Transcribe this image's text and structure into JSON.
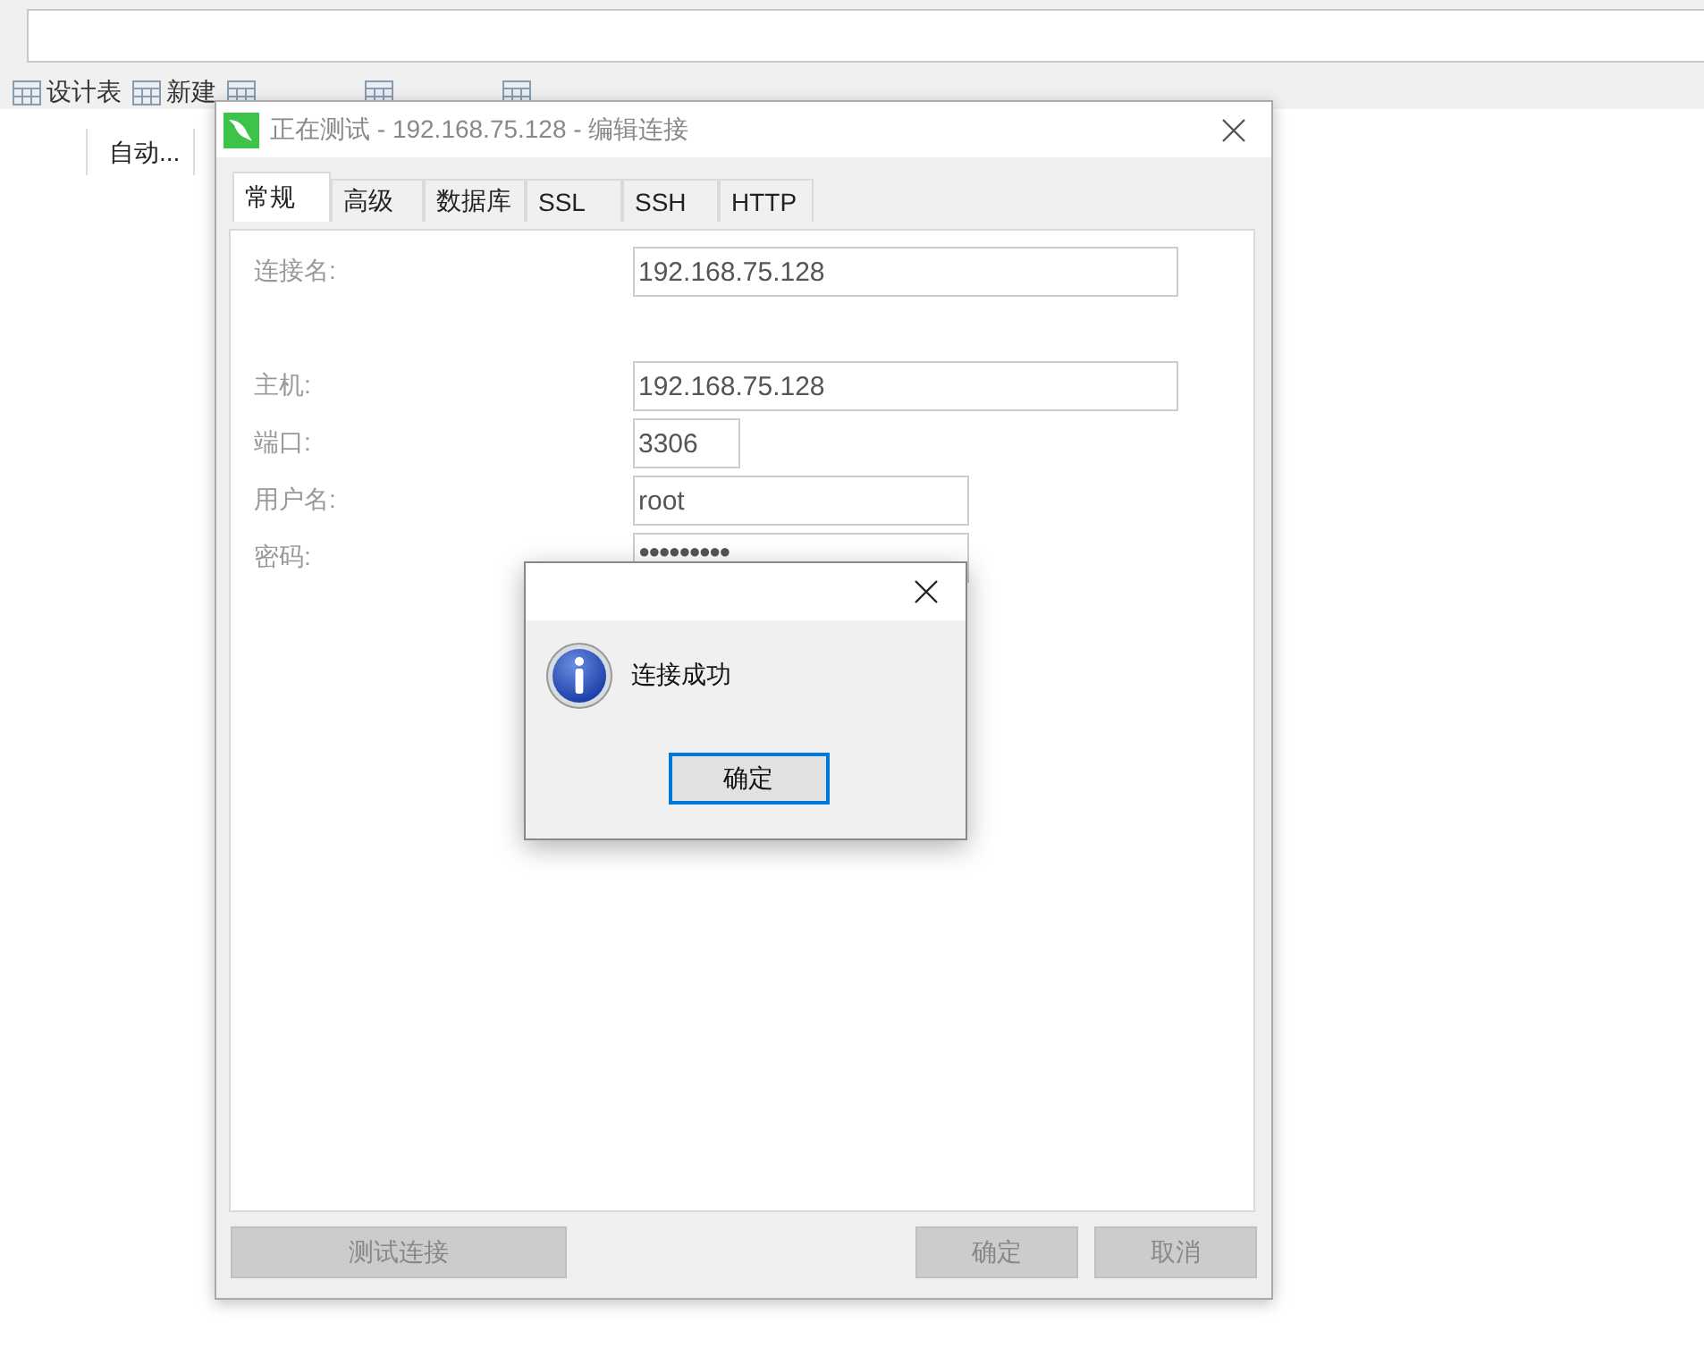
{
  "toolbar_labels": [
    "设计表",
    "新建"
  ],
  "columns": [
    "自动..."
  ],
  "dialog": {
    "title": "正在测试 - 192.168.75.128 - 编辑连接",
    "tabs": [
      {
        "label": "常规",
        "selected": true
      },
      {
        "label": "高级",
        "selected": false
      },
      {
        "label": "数据库",
        "selected": false
      },
      {
        "label": "SSL",
        "selected": false
      },
      {
        "label": "SSH",
        "selected": false
      },
      {
        "label": "HTTP",
        "selected": false
      }
    ],
    "fields": [
      {
        "label": "连接名:",
        "value": "192.168.75.128"
      },
      {
        "label": "主机:",
        "value": "192.168.75.128"
      },
      {
        "label": "端口:",
        "value": "3306"
      },
      {
        "label": "用户名:",
        "value": "root"
      },
      {
        "label": "密码:",
        "value": "●●●●●●●●●"
      }
    ],
    "buttons": [
      {
        "label": "测试连接",
        "disabled": true
      },
      {
        "label": "确定",
        "disabled": true
      },
      {
        "label": "取消",
        "disabled": true
      }
    ]
  },
  "message_box": {
    "message": "连接成功",
    "button": "确定"
  }
}
